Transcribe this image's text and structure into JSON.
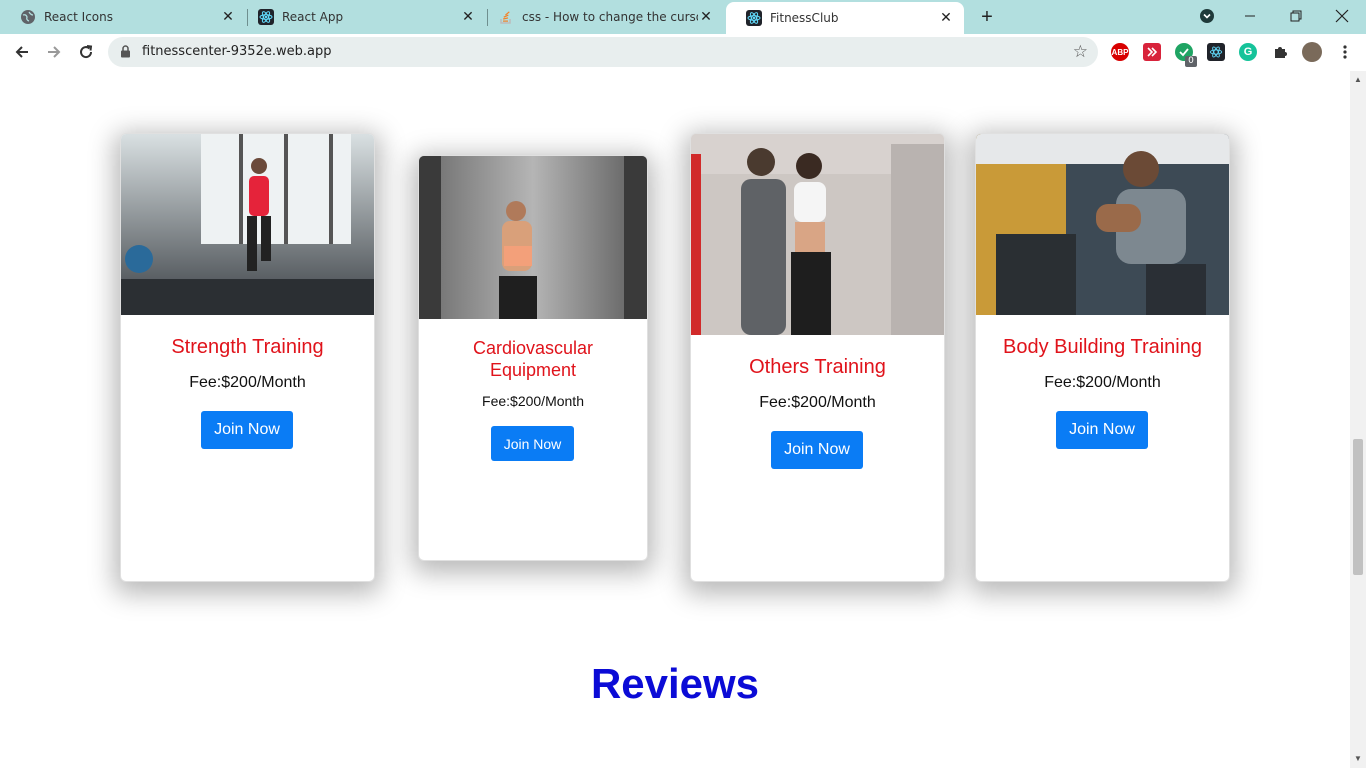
{
  "browser": {
    "tabs": [
      {
        "title": "React Icons",
        "active": false
      },
      {
        "title": "React App",
        "active": false
      },
      {
        "title": "css - How to change the cursor in",
        "active": false
      },
      {
        "title": "FitnessClub",
        "active": true
      }
    ],
    "url": "fitnesscenter-9352e.web.app",
    "extensions": [
      "abp",
      "video-speed",
      "todo",
      "react-devtools",
      "grammarly",
      "puzzle",
      "profile"
    ],
    "extension_badge": "0"
  },
  "services": [
    {
      "name": "Strength Training",
      "fee": "Fee:$200/Month",
      "button": "Join Now",
      "photo_colors": [
        "#cfd6d8",
        "#2d3135"
      ]
    },
    {
      "name": "Cardiovascular Equipment",
      "fee": "Fee:$200/Month",
      "button": "Join Now",
      "photo_colors": [
        "#9a9a9a",
        "#3a3a3a"
      ]
    },
    {
      "name": "Others Training",
      "fee": "Fee:$200/Month",
      "button": "Join Now",
      "photo_colors": [
        "#c9c3c0",
        "#2a2a2a"
      ]
    },
    {
      "name": "Body Building Training",
      "fee": "Fee:$200/Month",
      "button": "Join Now",
      "photo_colors": [
        "#c89a3a",
        "#3d4a55"
      ]
    }
  ],
  "reviews_heading": "Reviews",
  "colors": {
    "accent": "#0a7cf5",
    "service_title": "#e0131b",
    "reviews_title": "#0b0bd6"
  }
}
